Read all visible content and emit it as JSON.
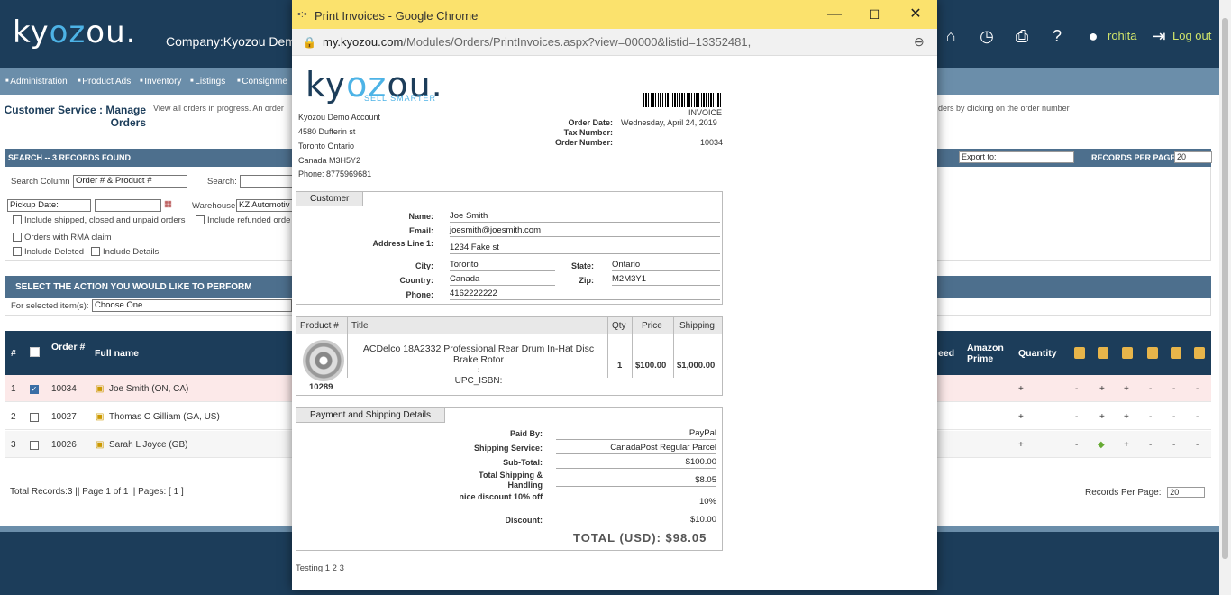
{
  "app": {
    "logo_text": "kyozou",
    "company": "Company:Kyozou Demo",
    "user": "rohita",
    "logout": "Log out",
    "nav": [
      "Administration",
      "Product Ads",
      "Inventory",
      "Listings",
      "Consignme"
    ],
    "cs_title": "Customer Service : Manage Orders",
    "cs_desc": "View all orders in progress. An order",
    "cs_desc_right": "ders by clicking on the order number",
    "search_header": "SEARCH -- 3 RECORDS FOUND",
    "export_label": "Export to:",
    "rpp_label": "RECORDS PER PAGE:",
    "rpp_value": "20",
    "search_column_label": "Search Column",
    "search_column_value": "Order # & Product #",
    "search_label": "Search:",
    "pickup_date": "Pickup Date:",
    "warehouse_label": "Warehouse",
    "warehouse_value": "KZ Automotiv",
    "cb_shipped": "Include shipped, closed and unpaid orders",
    "cb_refunded": "Include refunded orde",
    "cb_rma": "Orders with RMA claim",
    "cb_deleted": "Include Deleted",
    "cb_details": "Include Details",
    "action_header": "SELECT THE ACTION YOU WOULD LIKE TO PERFORM",
    "action_label": "For selected item(s):",
    "action_value": "Choose One",
    "table": {
      "headers": [
        "#",
        "Order #",
        "Full name",
        "eed",
        "Amazon Prime",
        "Quantity"
      ],
      "rows": [
        {
          "n": "1",
          "order": "10034",
          "name": "Joe Smith (ON, CA)",
          "checked": true
        },
        {
          "n": "2",
          "order": "10027",
          "name": "Thomas C Gilliam (GA, US)",
          "checked": false
        },
        {
          "n": "3",
          "order": "10026",
          "name": "Sarah L Joyce (GB)",
          "checked": false
        }
      ]
    },
    "total_records": "Total Records:3 || Page 1 of 1 || Pages: [ 1 ]",
    "rpp_bottom": "Records Per Page:"
  },
  "popup": {
    "title": "Print Invoices - Google Chrome",
    "url_host": "my.kyozou.com",
    "url_path": "/Modules/Orders/PrintInvoices.aspx?view=00000&listid=13352481,",
    "logo_text": "kyozou",
    "tagline": "SELL SMARTER",
    "invoice_word": "INVOICE",
    "seller": [
      "Kyozou Demo Account",
      "4580 Dufferin st",
      "Toronto   Ontario",
      "Canada   M3H5Y2",
      "Phone:  8775969681"
    ],
    "order_date_label": "Order Date:",
    "order_date": "Wednesday, April 24, 2019",
    "tax_label": "Tax Number:",
    "order_number_label": "Order Number:",
    "order_number": "10034",
    "customer": {
      "tab": "Customer",
      "name_label": "Name:",
      "name": "Joe Smith",
      "email_label": "Email:",
      "email": "joesmith@joesmith.com",
      "address_label": "Address Line 1:",
      "address": "1234 Fake st",
      "city_label": "City:",
      "city": "Toronto",
      "state_label": "State:",
      "state": "Ontario",
      "country_label": "Country:",
      "country": "Canada",
      "zip_label": "Zip:",
      "zip": "M2M3Y1",
      "phone_label": "Phone:",
      "phone": "4162222222"
    },
    "products": {
      "headers": [
        "Product #",
        "Title",
        "Qty",
        "Price",
        "Shipping"
      ],
      "sku": "10289",
      "title": "ACDelco 18A2332 Professional Rear Drum In-Hat Disc Brake Rotor",
      "colon": ":",
      "upc": "UPC_ISBN:",
      "qty": "1",
      "price": "$100.00",
      "shipping": "$1,000.00"
    },
    "payment": {
      "tab": "Payment and Shipping Details",
      "paid_by_label": "Paid By:",
      "paid_by": "PayPal",
      "service_label": "Shipping Service:",
      "service": "CanadaPost   Regular Parcel",
      "subtotal_label": "Sub-Total:",
      "subtotal": "$100.00",
      "tsh_label": "Total Shipping & Handling",
      "tsh": "$8.05",
      "discount10_label": "nice discount 10% off",
      "discount10": "10%",
      "discount_label": "Discount:",
      "discount": "$10.00",
      "total": "TOTAL (USD): $98.05"
    },
    "notes": "Testing 1 2 3"
  }
}
